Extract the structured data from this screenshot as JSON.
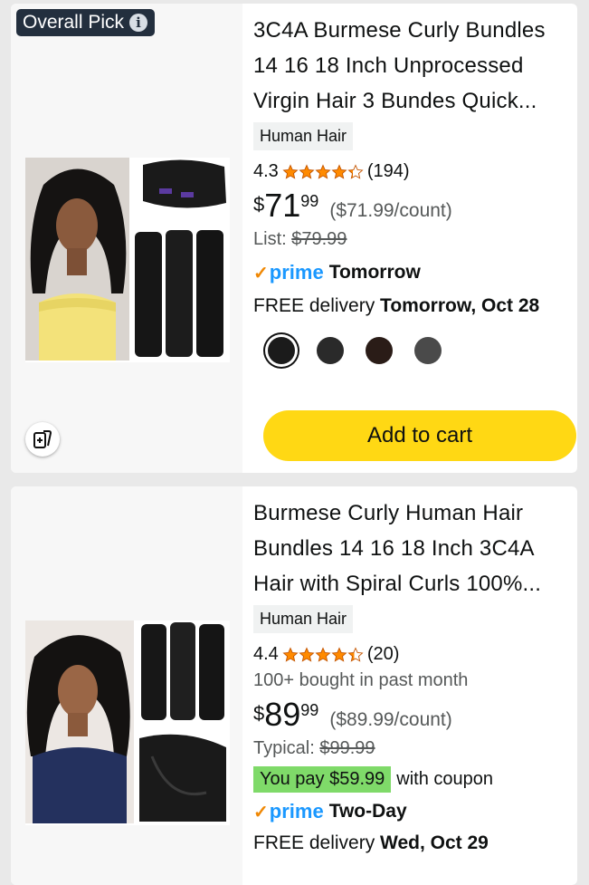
{
  "products": [
    {
      "badge": "Overall Pick",
      "title": "3C4A Burmese Curly Bundles 14 16 18 Inch Unprocessed Virgin Hair 3 Bundes Quick...",
      "chip": "Human Hair",
      "rating": "4.3",
      "rating_value": 4.3,
      "reviews": "(194)",
      "price_symbol": "$",
      "price_whole": "71",
      "price_fraction": "99",
      "unit_price": "($71.99/count)",
      "list_label": "List:",
      "list_price": "$79.99",
      "prime_word": "prime",
      "prime_when": "Tomorrow",
      "delivery_prefix": "FREE delivery",
      "delivery_date": "Tomorrow, Oct 28",
      "swatch_colors": [
        "#1b1b1b",
        "#2a2a2a",
        "#2a1c17",
        "#4a4a4a"
      ],
      "add_to_cart": "Add to cart"
    },
    {
      "title": "Burmese Curly Human Hair Bundles 14 16 18 Inch 3C4A Hair with Spiral Curls 100%...",
      "chip": "Human Hair",
      "rating": "4.4",
      "rating_value": 4.4,
      "reviews": "(20)",
      "bought": "100+ bought in past month",
      "price_symbol": "$",
      "price_whole": "89",
      "price_fraction": "99",
      "unit_price": "($89.99/count)",
      "typical_label": "Typical:",
      "typical_price": "$99.99",
      "you_pay": "You pay $59.99",
      "with_coupon": "with coupon",
      "prime_word": "prime",
      "prime_when": "Two-Day",
      "delivery_prefix": "FREE delivery",
      "delivery_date": "Wed, Oct 29"
    }
  ],
  "colors": {
    "star": "#ff8a00",
    "prime": "#1a98ff",
    "button": "#ffd814",
    "coupon": "#7fda69"
  },
  "icons": [
    "info-icon",
    "compare-icon",
    "star-icon",
    "prime-check-icon"
  ]
}
